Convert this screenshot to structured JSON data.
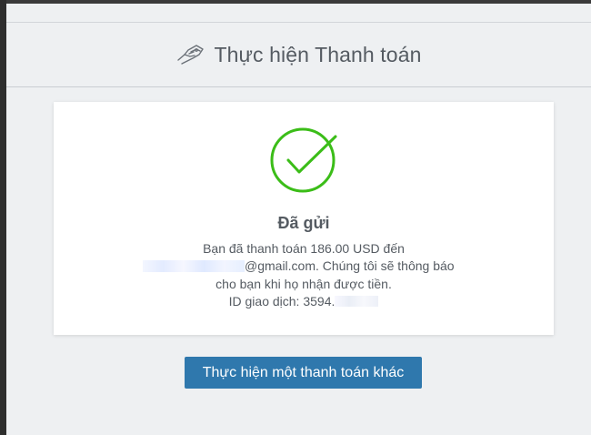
{
  "header": {
    "title": "Thực hiện Thanh toán",
    "icon": "hand-money-icon"
  },
  "result": {
    "status_icon": "checkmark-circle-icon",
    "status_color": "#3bbd18",
    "title": "Đã gửi",
    "line1": "Bạn đã thanh toán 186.00 USD đến",
    "line2_suffix": "@gmail.com. Chúng tôi sẽ thông báo",
    "line3": "cho bạn khi họ nhận được tiền.",
    "line4_prefix": "ID giao dịch: 3594."
  },
  "actions": {
    "another_payment_label": "Thực hiện một thanh toán khác",
    "button_color": "#2f78ad"
  }
}
